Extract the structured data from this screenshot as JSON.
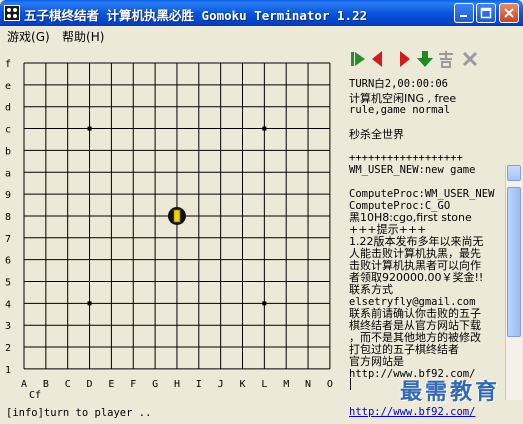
{
  "window": {
    "title": "五子棋终结者 计算机执黑必胜 Gomoku Terminator 1.22",
    "controls": [
      "minimize-icon",
      "maximize-icon",
      "close-icon"
    ]
  },
  "menu": {
    "game": "游戏",
    "game_key": "(G)",
    "help": "帮助",
    "help_key": "(H)"
  },
  "board": {
    "columns": [
      "A",
      "B",
      "C",
      "D",
      "E",
      "F",
      "G",
      "H",
      "I",
      "J",
      "K",
      "L",
      "M",
      "N",
      "O"
    ],
    "rows_top_to_bottom": [
      "f",
      "e",
      "d",
      "c",
      "b",
      "a",
      "9",
      "8",
      "7",
      "6",
      "5",
      "4",
      "3",
      "2",
      "1"
    ],
    "star_points": [
      "D12",
      "L12",
      "D4",
      "L4"
    ],
    "stone": {
      "point": "H8",
      "color": "black",
      "marker": "yellow last-move marker"
    },
    "bottom_label": "Cf"
  },
  "toolbar": {
    "buttons": [
      {
        "name": "first-move-button",
        "icon": "skip-to-start-icon",
        "color": "#2e8b2e",
        "enabled": true
      },
      {
        "name": "undo-button",
        "icon": "arrow-left-icon",
        "color": "#d21c1c",
        "enabled": true
      },
      {
        "name": "redo-button",
        "icon": "arrow-right-icon",
        "color": "#d21c1c",
        "enabled": true
      },
      {
        "name": "download-button",
        "icon": "arrow-down-icon",
        "color": "#1f8a1f",
        "enabled": true
      },
      {
        "name": "compute-button",
        "icon": "calc-icon",
        "color": "#9a9a9a",
        "enabled": false
      },
      {
        "name": "stop-button",
        "icon": "cross-icon",
        "color": "#9a9a9a",
        "enabled": false
      }
    ]
  },
  "info": {
    "turn": "TURN白2,00:00:06",
    "status": "计算机空闲ING , free",
    "rule": "rule,game normal",
    "slogan": "秒杀全世界"
  },
  "log": [
    {
      "text": "++++++++++++++++++",
      "zh": false
    },
    {
      "text": "WM_USER_NEW:new game",
      "zh": false
    },
    {
      "text": "",
      "zh": false
    },
    {
      "text": "ComputeProc:WM_USER_NEW",
      "zh": false
    },
    {
      "text": "ComputeProc:C_GO",
      "zh": false
    },
    {
      "text": "黑10H8:cgo,first stone",
      "zh": true
    },
    {
      "text": "+++提示+++",
      "zh": true
    },
    {
      "text": "1.22版本发布多年以来尚无",
      "zh": true
    },
    {
      "text": "人能击败计算机执黑，最先",
      "zh": true
    },
    {
      "text": "击败计算机执黑者可以向作",
      "zh": true
    },
    {
      "text": "者领取920000.00￥奖金!!",
      "zh": true
    },
    {
      "text": "联系方式",
      "zh": true
    },
    {
      "text": "elsetryfly@gmail.com",
      "zh": false
    },
    {
      "text": "联系前请确认你击败的五子",
      "zh": true
    },
    {
      "text": "棋终结者是从官方网站下载",
      "zh": true
    },
    {
      "text": "，而不是其他地方的被修改",
      "zh": true
    },
    {
      "text": "打包过的五子棋终结者",
      "zh": true
    },
    {
      "text": "官方网站是",
      "zh": true
    },
    {
      "text": "http://www.bf92.com/",
      "zh": false
    }
  ],
  "status_bar": {
    "message": "[info]turn to player ..",
    "link": "http://www.bf92.com/"
  },
  "watermark": "最需教育",
  "colors": {
    "titlebar": "#0956db",
    "board_bg": "#ece9d8",
    "grid": "#000000",
    "marker": "#f2d20a",
    "link": "#0000cc"
  }
}
